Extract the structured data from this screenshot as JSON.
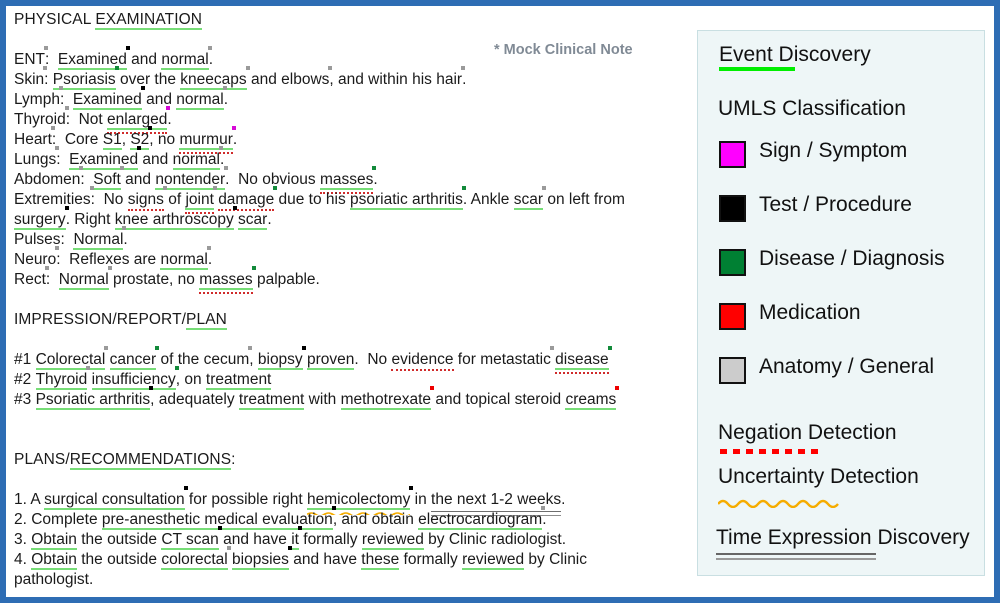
{
  "meta": {
    "mock_label": "* Mock Clinical Note",
    "border_color": "#2e6db4",
    "legend_bg": "#eef6f7"
  },
  "note": {
    "sections": [
      {
        "heading_plain": "PHYSICAL ",
        "heading_event": "EXAMINATION"
      },
      {
        "heading_plain": "IMPRESSION/REPORT/",
        "heading_event": "PLAN"
      },
      {
        "heading_plain": "PLANS/",
        "heading_event": "RECOMMENDATIONS",
        "heading_tail": ":"
      }
    ],
    "lines": [
      {
        "id": "l-ent",
        "tokens": [
          {
            "t": "ENT",
            "mark": "anat"
          },
          {
            "t": ":  "
          },
          {
            "t": "Examined",
            "ev": true,
            "mark": "test"
          },
          {
            "t": " and "
          },
          {
            "t": "normal",
            "ev": true,
            "mark": "anat"
          },
          {
            "t": "."
          }
        ]
      },
      {
        "id": "l-skin",
        "tokens": [
          {
            "t": "Skin",
            "mark": "anat"
          },
          {
            "t": ": "
          },
          {
            "t": "Psoriasis",
            "ev": true,
            "mark": "dis"
          },
          {
            "t": " over the "
          },
          {
            "t": "kneecaps",
            "ev": true,
            "mark": "anat"
          },
          {
            "t": " and "
          },
          {
            "t": "elbows",
            "mark": "anat"
          },
          {
            "t": ", and within his "
          },
          {
            "t": "hair",
            "mark": "anat"
          },
          {
            "t": "."
          }
        ]
      },
      {
        "id": "l-lymph",
        "tokens": [
          {
            "t": "Lymph",
            "mark": "anat"
          },
          {
            "t": ":  "
          },
          {
            "t": "Examined",
            "ev": true,
            "mark": "test"
          },
          {
            "t": " and "
          },
          {
            "t": "normal",
            "ev": true,
            "mark": "anat"
          },
          {
            "t": "."
          }
        ]
      },
      {
        "id": "l-thyroid",
        "tokens": [
          {
            "t": "Thyroid",
            "mark": "anat"
          },
          {
            "t": ":  Not "
          },
          {
            "t": "enlarged",
            "ev": true,
            "neg": true,
            "mark": "sign"
          },
          {
            "t": "."
          }
        ]
      },
      {
        "id": "l-heart",
        "tokens": [
          {
            "t": "Heart",
            "mark": "anat"
          },
          {
            "t": ":  Core "
          },
          {
            "t": "S1",
            "ev": true
          },
          {
            "t": ", "
          },
          {
            "t": "S2",
            "ev": true,
            "mark": "test"
          },
          {
            "t": ", no "
          },
          {
            "t": "murmur",
            "ev": true,
            "neg": true,
            "mark": "sign"
          },
          {
            "t": "."
          }
        ]
      },
      {
        "id": "l-lungs",
        "tokens": [
          {
            "t": "Lungs",
            "mark": "anat"
          },
          {
            "t": ":  "
          },
          {
            "t": "Examined",
            "ev": true,
            "mark": "test"
          },
          {
            "t": " and "
          },
          {
            "t": "normal",
            "ev": true,
            "mark": "anat"
          },
          {
            "t": "."
          }
        ]
      },
      {
        "id": "l-abdomen",
        "tokens": [
          {
            "t": "Abdomen",
            "mark": "anat"
          },
          {
            "t": ":  "
          },
          {
            "t": "Soft",
            "ev": true,
            "mark": "anat"
          },
          {
            "t": " and "
          },
          {
            "t": "nontender",
            "ev": true,
            "mark": "anat"
          },
          {
            "t": ".  No obvious "
          },
          {
            "t": "masses",
            "ev": true,
            "neg": true,
            "mark": "dis"
          },
          {
            "t": "."
          }
        ]
      },
      {
        "id": "l-extrem1",
        "tokens": [
          {
            "t": "Extremities",
            "mark": "anat"
          },
          {
            "t": ":  No "
          },
          {
            "t": "signs",
            "neg": true,
            "mark": "anat"
          },
          {
            "t": " of "
          },
          {
            "t": "joint",
            "ev": true,
            "neg": true,
            "mark": "anat"
          },
          {
            "t": " "
          },
          {
            "t": "damage",
            "neg": true,
            "mark": "dis"
          },
          {
            "t": " due to his "
          },
          {
            "t": "psoriatic arthritis",
            "ev": true,
            "mark": "dis"
          },
          {
            "t": ". Ankle "
          },
          {
            "t": "scar",
            "ev": true,
            "mark": "anat"
          },
          {
            "t": " on left from"
          }
        ]
      },
      {
        "id": "l-extrem2",
        "tokens": [
          {
            "t": "surgery",
            "ev": true,
            "mark": "test"
          },
          {
            "t": ". Right "
          },
          {
            "t": "knee arthroscopy",
            "ev": true,
            "mark": "test"
          },
          {
            "t": " "
          },
          {
            "t": "scar",
            "ev": true
          },
          {
            "t": "."
          }
        ]
      },
      {
        "id": "l-pulses",
        "tokens": [
          {
            "t": "Pulses:  "
          },
          {
            "t": "Normal",
            "ev": true,
            "mark": "anat"
          },
          {
            "t": "."
          }
        ]
      },
      {
        "id": "l-neuro",
        "tokens": [
          {
            "t": "Neuro",
            "mark": "anat"
          },
          {
            "t": ":  Reflexes are "
          },
          {
            "t": "normal",
            "ev": true,
            "mark": "anat"
          },
          {
            "t": "."
          }
        ]
      },
      {
        "id": "l-rect",
        "tokens": [
          {
            "t": "Rect",
            "mark": "anat"
          },
          {
            "t": ":  "
          },
          {
            "t": "Normal",
            "ev": true,
            "mark": "anat"
          },
          {
            "t": " prostate, no "
          },
          {
            "t": "masses",
            "ev": true,
            "neg": true,
            "mark": "dis"
          },
          {
            "t": " palpable."
          }
        ]
      },
      {
        "id": "l-imp1",
        "tokens": [
          {
            "t": "#1 "
          },
          {
            "t": "Colorectal",
            "ev": true,
            "mark": "anat"
          },
          {
            "t": " "
          },
          {
            "t": "cancer",
            "ev": true,
            "mark": "dis"
          },
          {
            "t": " of the "
          },
          {
            "t": "cecum",
            "mark": "anat"
          },
          {
            "t": ", "
          },
          {
            "t": "biopsy",
            "ev": true,
            "mark": "test"
          },
          {
            "t": " "
          },
          {
            "t": "proven",
            "ev": true
          },
          {
            "t": ".  No "
          },
          {
            "t": "evidence",
            "neg": true
          },
          {
            "t": " for "
          },
          {
            "t": "metastatic",
            "mark": "anat"
          },
          {
            "t": " "
          },
          {
            "t": "disease",
            "ev": true,
            "neg": true,
            "mark": "dis"
          }
        ]
      },
      {
        "id": "l-imp2",
        "tokens": [
          {
            "t": "#2 "
          },
          {
            "t": "Thyroid",
            "ev": true,
            "mark": "anat"
          },
          {
            "t": " "
          },
          {
            "t": "insufficiency",
            "ev": true,
            "mark": "dis"
          },
          {
            "t": ", on "
          },
          {
            "t": "treatment",
            "ev": true
          }
        ]
      },
      {
        "id": "l-imp3",
        "tokens": [
          {
            "t": "#3 "
          },
          {
            "t": "Psoriatic arthritis",
            "ev": true,
            "mark": "test"
          },
          {
            "t": ", adequately "
          },
          {
            "t": "treatment",
            "ev": true
          },
          {
            "t": " with "
          },
          {
            "t": "methotrexate",
            "ev": true,
            "mark": "med"
          },
          {
            "t": " and topical steroid "
          },
          {
            "t": "creams",
            "ev": true,
            "mark": "med"
          }
        ]
      },
      {
        "id": "l-plan1",
        "tokens": [
          {
            "t": "1. A "
          },
          {
            "t": "surgical consultation",
            "ev": true,
            "mark": "test"
          },
          {
            "t": " for possible right "
          },
          {
            "t": "hemicolectomy",
            "ev": true,
            "unc": true,
            "mark": "test"
          },
          {
            "t": " in "
          },
          {
            "t": "the next 1-2 weeks",
            "time": true
          },
          {
            "t": "."
          }
        ]
      },
      {
        "id": "l-plan2",
        "tokens": [
          {
            "t": "2. Complete "
          },
          {
            "t": "pre-anesthetic medical evaluation",
            "ev": true,
            "mark": "test"
          },
          {
            "t": ", and obtain "
          },
          {
            "t": "electrocardiogram",
            "ev": true,
            "mark": "anat"
          },
          {
            "t": "."
          }
        ]
      },
      {
        "id": "l-plan3",
        "tokens": [
          {
            "t": "3. "
          },
          {
            "t": "Obtain",
            "ev": true
          },
          {
            "t": " the outside "
          },
          {
            "t": "CT scan",
            "ev": true,
            "mark": "test"
          },
          {
            "t": " and have "
          },
          {
            "t": "it",
            "ev": true,
            "mark": "test"
          },
          {
            "t": " formally "
          },
          {
            "t": "reviewed",
            "ev": true
          },
          {
            "t": " by Clinic radiologist."
          }
        ]
      },
      {
        "id": "l-plan4",
        "tokens": [
          {
            "t": "4. "
          },
          {
            "t": "Obtain",
            "ev": true
          },
          {
            "t": " the outside "
          },
          {
            "t": "colorectal",
            "ev": true,
            "mark": "anat"
          },
          {
            "t": " "
          },
          {
            "t": "biopsies",
            "ev": true,
            "mark": "test"
          },
          {
            "t": " and have "
          },
          {
            "t": "these",
            "ev": true
          },
          {
            "t": " formally "
          },
          {
            "t": "reviewed",
            "ev": true
          },
          {
            "t": " by Clinic"
          }
        ]
      },
      {
        "id": "l-plan5",
        "tokens": [
          {
            "t": "pathologist."
          }
        ]
      }
    ]
  },
  "legend": {
    "event_discovery": "Event Discovery",
    "umls_title": "UMLS Classification",
    "umls_items": [
      {
        "label": "Sign / Symptom",
        "color": "#ff00ff",
        "key": "sign"
      },
      {
        "label": "Test / Procedure",
        "color": "#000000",
        "key": "test"
      },
      {
        "label": "Disease / Diagnosis",
        "color": "#008033",
        "key": "dis"
      },
      {
        "label": "Medication",
        "color": "#ff0000",
        "key": "med"
      },
      {
        "label": "Anatomy / General",
        "color": "#cccccc",
        "key": "anat"
      }
    ],
    "negation": "Negation Detection",
    "uncertainty": "Uncertainty Detection",
    "time_expression": "Time Expression Discovery",
    "event_underline_color": "#00ee00",
    "negation_color": "#ff0000",
    "uncertainty_color": "#f5ac00",
    "time_color": "#666666"
  }
}
